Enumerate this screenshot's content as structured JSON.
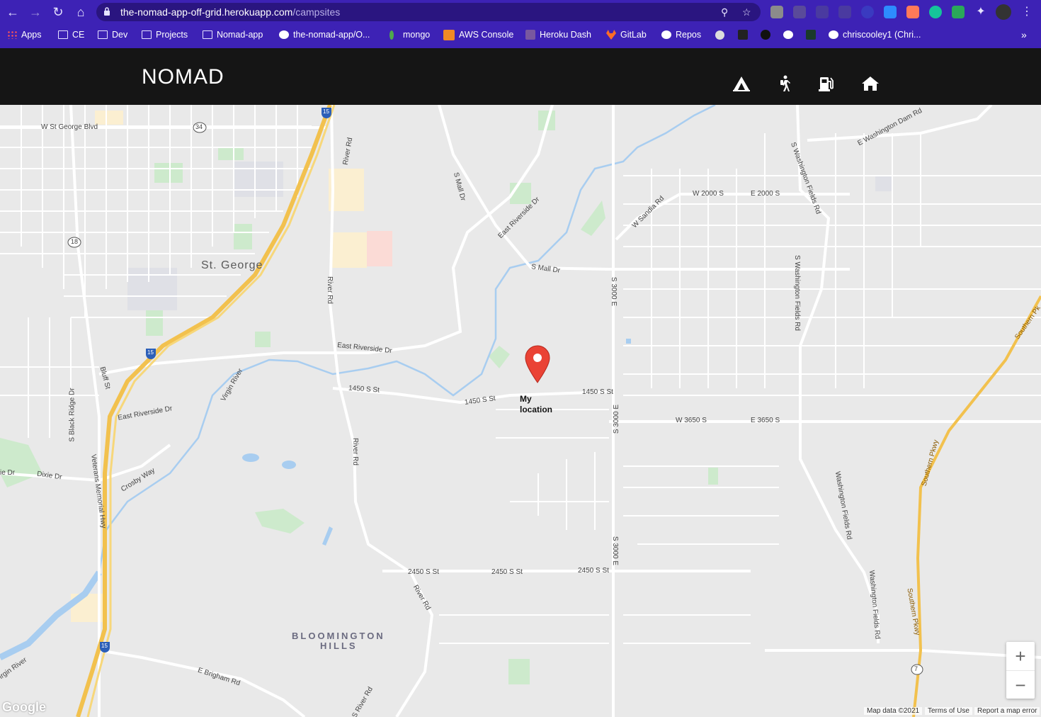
{
  "browser": {
    "url_host": "the-nomad-app-off-grid.herokuapp.com",
    "url_path": "/campsites",
    "bookmarks": [
      {
        "label": "Apps",
        "icon": "apps-grid-icon"
      },
      {
        "label": "CE",
        "icon": "folder-icon"
      },
      {
        "label": "Dev",
        "icon": "folder-icon"
      },
      {
        "label": "Projects",
        "icon": "folder-icon"
      },
      {
        "label": "Nomad-app",
        "icon": "folder-icon"
      },
      {
        "label": "the-nomad-app/O...",
        "icon": "github-icon"
      },
      {
        "label": "mongo",
        "icon": "mongo-leaf-icon"
      },
      {
        "label": "AWS Console",
        "icon": "aws-icon"
      },
      {
        "label": "Heroku Dash",
        "icon": "heroku-icon"
      },
      {
        "label": "GitLab",
        "icon": "gitlab-icon"
      },
      {
        "label": "Repos",
        "icon": "github-icon"
      },
      {
        "label": "chriscooley1 (Chri...",
        "icon": "github-icon"
      }
    ],
    "overflow": "»"
  },
  "app": {
    "logo": "NOMAD",
    "nav": [
      {
        "name": "campsites",
        "icon": "tent-icon"
      },
      {
        "name": "hiking",
        "icon": "hiker-icon"
      },
      {
        "name": "fuel",
        "icon": "gas-pump-icon"
      },
      {
        "name": "home",
        "icon": "home-icon"
      }
    ]
  },
  "map": {
    "marker_label": "My location",
    "places": {
      "st_george": "St. George",
      "bloomington_hills_1": "BLOOMINGTON",
      "bloomington_hills_2": "HILLS"
    },
    "streets": {
      "w_st_george_blvd": "W St George Blvd",
      "route_34": "34",
      "route_18": "18",
      "route_7": "7",
      "i15_a": "15",
      "i15_b": "15",
      "i15_c": "15",
      "river_rd_1": "River Rd",
      "river_rd_2": "River Rd",
      "river_rd_3": "River Rd",
      "river_rd_4": "River Rd",
      "river_rd_5": "S River Rd",
      "s_mall_dr_1": "S Mall Dr",
      "s_mall_dr_2": "S Mall Dr",
      "east_riverside_dr_1": "East Riverside Dr",
      "east_riverside_dr_2": "East Riverside Dr",
      "east_riverside_dr_3": "East Riverside Dr",
      "w_sandia_rd": "W Sandia Rd",
      "w_2000_s": "W 2000 S",
      "e_2000_s": "E 2000 S",
      "e_washington_dam_rd": "E Washington Dam Rd",
      "s_washington_fields_rd_1": "S Washington Fields Rd",
      "s_washington_fields_rd_2": "S Washington Fields Rd",
      "washington_fields_rd_1": "Washington Fields Rd",
      "washington_fields_rd_2": "Washington Fields Rd",
      "s_3000_e_1": "S 3000 E",
      "s_3000_e_2": "S 3000 E",
      "s_3000_e_3": "S 3000 E",
      "w_3650_s": "W 3650 S",
      "e_3650_s": "E 3650 S",
      "s_1450_1": "1450 S St",
      "s_1450_2": "1450 S St",
      "s_1450_3": "1450 S St",
      "s_2450_1": "2450 S St",
      "s_2450_2": "2450 S St",
      "s_2450_3": "2450 S St",
      "bluff_st": "Bluff St",
      "s_black_ridge_dr": "S Black Ridge Dr",
      "virgin_river_1": "Virgin River",
      "virgin_river_2": "irgin River",
      "dixie_dr_1": "Dixie Dr",
      "dixie_dr_2": "ie Dr",
      "crosby_way": "Crosby Way",
      "veterans_memorial_hwy": "Veterans Memorial Hwy",
      "e_brigham_rd": "E Brigham Rd",
      "southern_pkwy_1": "Southern Pkwy",
      "southern_pkwy_2": "Southern Pkwy",
      "southern_pkwy_3": "Southern Pk"
    },
    "zoom_in": "+",
    "zoom_out": "−",
    "google": "Google",
    "attribution": {
      "map_data": "Map data ©2021",
      "terms": "Terms of Use",
      "report": "Report a map error"
    }
  }
}
